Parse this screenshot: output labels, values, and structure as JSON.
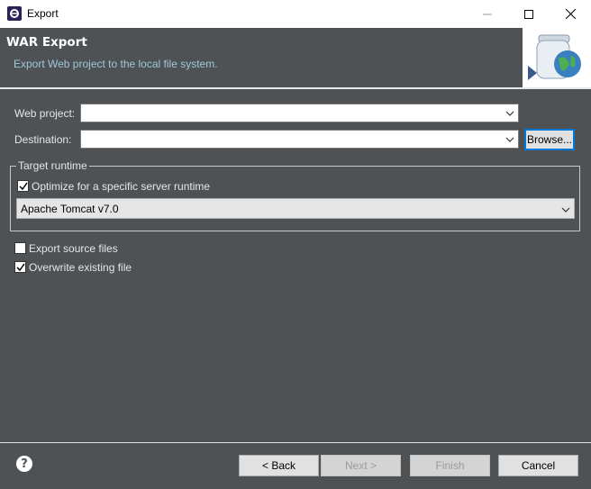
{
  "window": {
    "title": "Export"
  },
  "banner": {
    "title": "WAR Export",
    "description": "Export Web project to the local file system."
  },
  "form": {
    "web_project_label": "Web project:",
    "web_project_value": "",
    "destination_label": "Destination:",
    "destination_value": "",
    "browse_label": "Browse..."
  },
  "target_runtime": {
    "group_title": "Target runtime",
    "optimize_label": "Optimize for a specific server runtime",
    "optimize_checked": true,
    "runtime_selected": "Apache Tomcat v7.0"
  },
  "options": {
    "export_source_label": "Export source files",
    "export_source_checked": false,
    "overwrite_label": "Overwrite existing file",
    "overwrite_checked": true
  },
  "footer": {
    "help_glyph": "?",
    "back_label": "< Back",
    "next_label": "Next >",
    "finish_label": "Finish",
    "cancel_label": "Cancel"
  },
  "colors": {
    "panel": "#4e5254",
    "banner_desc": "#9fc7dd",
    "focus": "#0078d7"
  }
}
